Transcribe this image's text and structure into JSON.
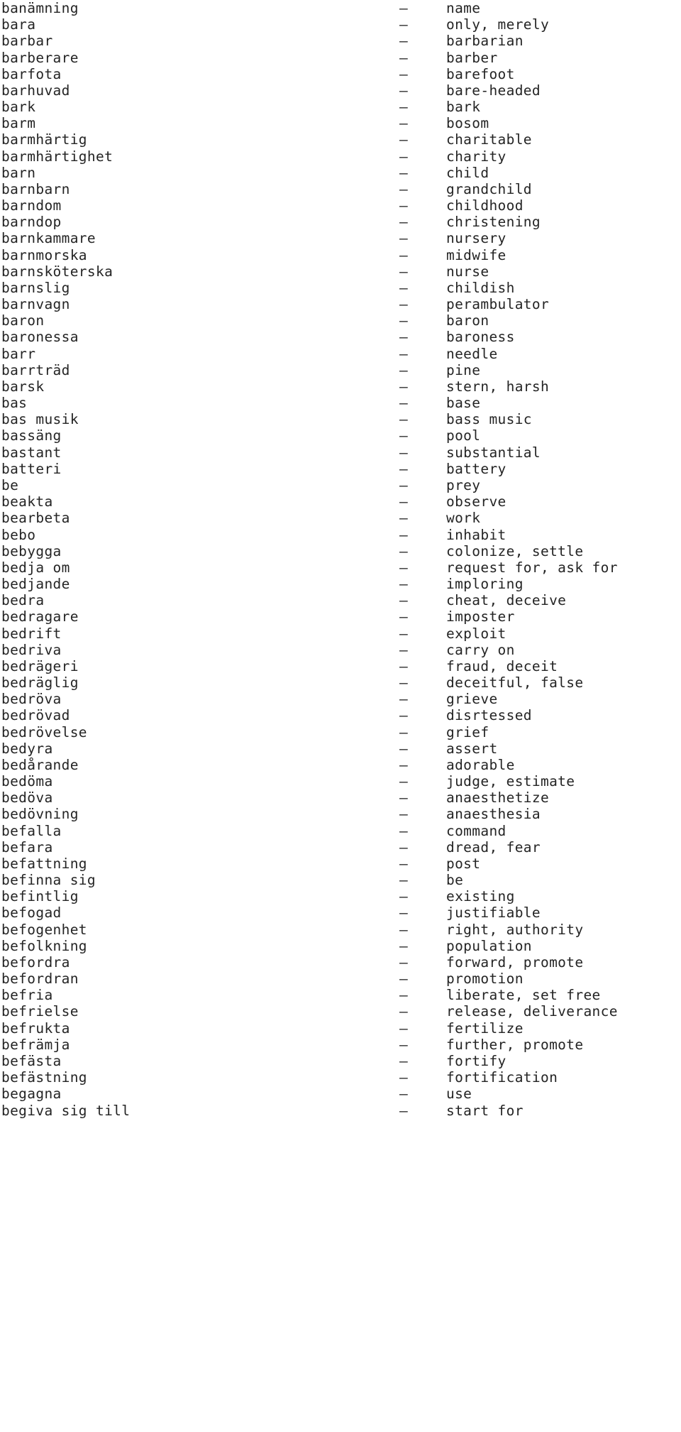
{
  "page": {
    "kind": "bilingual-dictionary-listing",
    "source_language": "Swedish",
    "target_language": "English",
    "separator": "–",
    "text_color": "#242424",
    "background_color": "#ffffff"
  },
  "entries": [
    {
      "term": "banämning",
      "sep": "–",
      "translation": "name"
    },
    {
      "term": "bara",
      "sep": "–",
      "translation": "only, merely"
    },
    {
      "term": "barbar",
      "sep": "–",
      "translation": "barbarian"
    },
    {
      "term": "barberare",
      "sep": "–",
      "translation": "barber"
    },
    {
      "term": "barfota",
      "sep": "–",
      "translation": "barefoot"
    },
    {
      "term": "barhuvad",
      "sep": "–",
      "translation": "bare-headed"
    },
    {
      "term": "bark",
      "sep": "–",
      "translation": "bark"
    },
    {
      "term": "barm",
      "sep": "–",
      "translation": "bosom"
    },
    {
      "term": "barmhärtig",
      "sep": "–",
      "translation": "charitable"
    },
    {
      "term": "barmhärtighet",
      "sep": "–",
      "translation": "charity"
    },
    {
      "term": "barn",
      "sep": "–",
      "translation": "child"
    },
    {
      "term": "barnbarn",
      "sep": "–",
      "translation": "grandchild"
    },
    {
      "term": "barndom",
      "sep": "–",
      "translation": "childhood"
    },
    {
      "term": "barndop",
      "sep": "–",
      "translation": "christening"
    },
    {
      "term": "barnkammare",
      "sep": "–",
      "translation": "nursery"
    },
    {
      "term": "barnmorska",
      "sep": "–",
      "translation": "midwife"
    },
    {
      "term": "barnsköterska",
      "sep": "–",
      "translation": "nurse"
    },
    {
      "term": "barnslig",
      "sep": "–",
      "translation": "childish"
    },
    {
      "term": "barnvagn",
      "sep": "–",
      "translation": "perambulator"
    },
    {
      "term": "baron",
      "sep": "–",
      "translation": "baron"
    },
    {
      "term": "baronessa",
      "sep": "–",
      "translation": "baroness"
    },
    {
      "term": "barr",
      "sep": "–",
      "translation": "needle"
    },
    {
      "term": "barrträd",
      "sep": "–",
      "translation": "pine"
    },
    {
      "term": "barsk",
      "sep": "–",
      "translation": "stern, harsh"
    },
    {
      "term": "bas",
      "sep": "–",
      "translation": "base"
    },
    {
      "term": "bas musik",
      "sep": "–",
      "translation": "bass music"
    },
    {
      "term": "bassäng",
      "sep": "–",
      "translation": "pool"
    },
    {
      "term": "bastant",
      "sep": "–",
      "translation": "substantial"
    },
    {
      "term": "batteri",
      "sep": "–",
      "translation": "battery"
    },
    {
      "term": "be",
      "sep": "–",
      "translation": "prey"
    },
    {
      "term": "beakta",
      "sep": "–",
      "translation": "observe"
    },
    {
      "term": "bearbeta",
      "sep": "–",
      "translation": "work"
    },
    {
      "term": "bebo",
      "sep": "–",
      "translation": "inhabit"
    },
    {
      "term": "bebygga",
      "sep": "–",
      "translation": "colonize, settle"
    },
    {
      "term": "bedja om",
      "sep": "–",
      "translation": "request for, ask for"
    },
    {
      "term": "bedjande",
      "sep": "–",
      "translation": "imploring"
    },
    {
      "term": "bedra",
      "sep": "–",
      "translation": "cheat, deceive"
    },
    {
      "term": "bedragare",
      "sep": "–",
      "translation": "imposter"
    },
    {
      "term": "bedrift",
      "sep": "–",
      "translation": "exploit"
    },
    {
      "term": "bedriva",
      "sep": "–",
      "translation": "carry on"
    },
    {
      "term": "bedrägeri",
      "sep": "–",
      "translation": "fraud, deceit"
    },
    {
      "term": "bedräglig",
      "sep": "–",
      "translation": "deceitful, false"
    },
    {
      "term": "bedröva",
      "sep": "–",
      "translation": "grieve"
    },
    {
      "term": "bedrövad",
      "sep": "–",
      "translation": "disrtessed"
    },
    {
      "term": "bedrövelse",
      "sep": "–",
      "translation": "grief"
    },
    {
      "term": "bedyra",
      "sep": "–",
      "translation": "assert"
    },
    {
      "term": "bedårande",
      "sep": "–",
      "translation": "adorable"
    },
    {
      "term": "bedöma",
      "sep": "–",
      "translation": "judge, estimate"
    },
    {
      "term": "bedöva",
      "sep": "–",
      "translation": "anaesthetize"
    },
    {
      "term": "bedövning",
      "sep": "–",
      "translation": "anaesthesia"
    },
    {
      "term": "befalla",
      "sep": "–",
      "translation": "command"
    },
    {
      "term": "befara",
      "sep": "–",
      "translation": "dread, fear"
    },
    {
      "term": "befattning",
      "sep": "–",
      "translation": "post"
    },
    {
      "term": "befinna sig",
      "sep": "–",
      "translation": "be"
    },
    {
      "term": "befintlig",
      "sep": "–",
      "translation": "existing"
    },
    {
      "term": "befogad",
      "sep": "–",
      "translation": "justifiable"
    },
    {
      "term": "befogenhet",
      "sep": "–",
      "translation": "right, authority"
    },
    {
      "term": "befolkning",
      "sep": "–",
      "translation": "population"
    },
    {
      "term": "befordra",
      "sep": "–",
      "translation": "forward, promote"
    },
    {
      "term": "befordran",
      "sep": "–",
      "translation": "promotion"
    },
    {
      "term": "befria",
      "sep": "–",
      "translation": "liberate, set free"
    },
    {
      "term": "befrielse",
      "sep": "–",
      "translation": "release, deliverance"
    },
    {
      "term": "befrukta",
      "sep": "–",
      "translation": "fertilize"
    },
    {
      "term": "befrämja",
      "sep": "–",
      "translation": "further, promote"
    },
    {
      "term": "befästa",
      "sep": "–",
      "translation": "fortify"
    },
    {
      "term": "befästning",
      "sep": "–",
      "translation": "fortification"
    },
    {
      "term": "begagna",
      "sep": "–",
      "translation": "use"
    },
    {
      "term": "begiva sig till",
      "sep": "–",
      "translation": "start for"
    }
  ]
}
